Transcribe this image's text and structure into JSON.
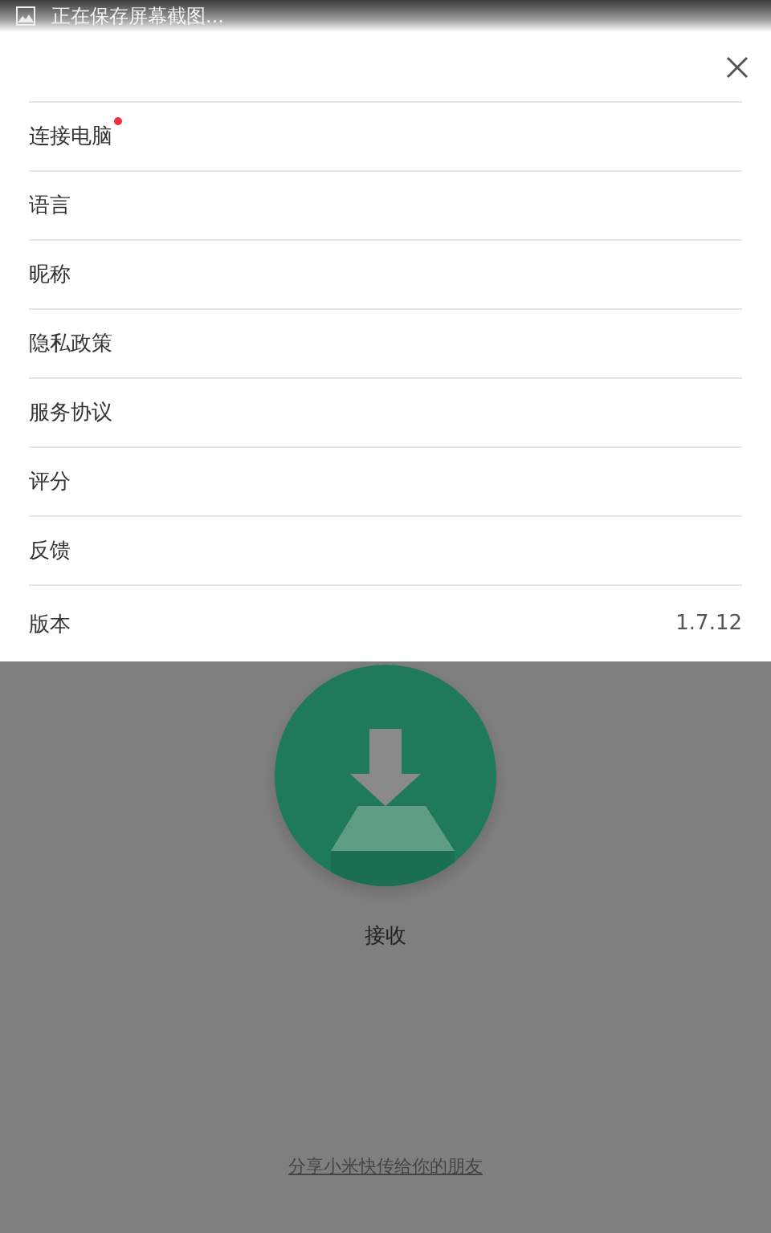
{
  "status_bar": {
    "text": "正在保存屏幕截图..."
  },
  "menu": {
    "items": [
      {
        "label": "连接电脑",
        "badge": true
      },
      {
        "label": "语言",
        "badge": false
      },
      {
        "label": "昵称",
        "badge": false
      },
      {
        "label": "隐私政策",
        "badge": false
      },
      {
        "label": "服务协议",
        "badge": false
      },
      {
        "label": "评分",
        "badge": false
      },
      {
        "label": "反馈",
        "badge": false
      },
      {
        "label": "版本",
        "badge": false,
        "value": "1.7.12"
      }
    ]
  },
  "receive": {
    "label": "接收"
  },
  "share_link": "分享小米快传给你的朋友"
}
